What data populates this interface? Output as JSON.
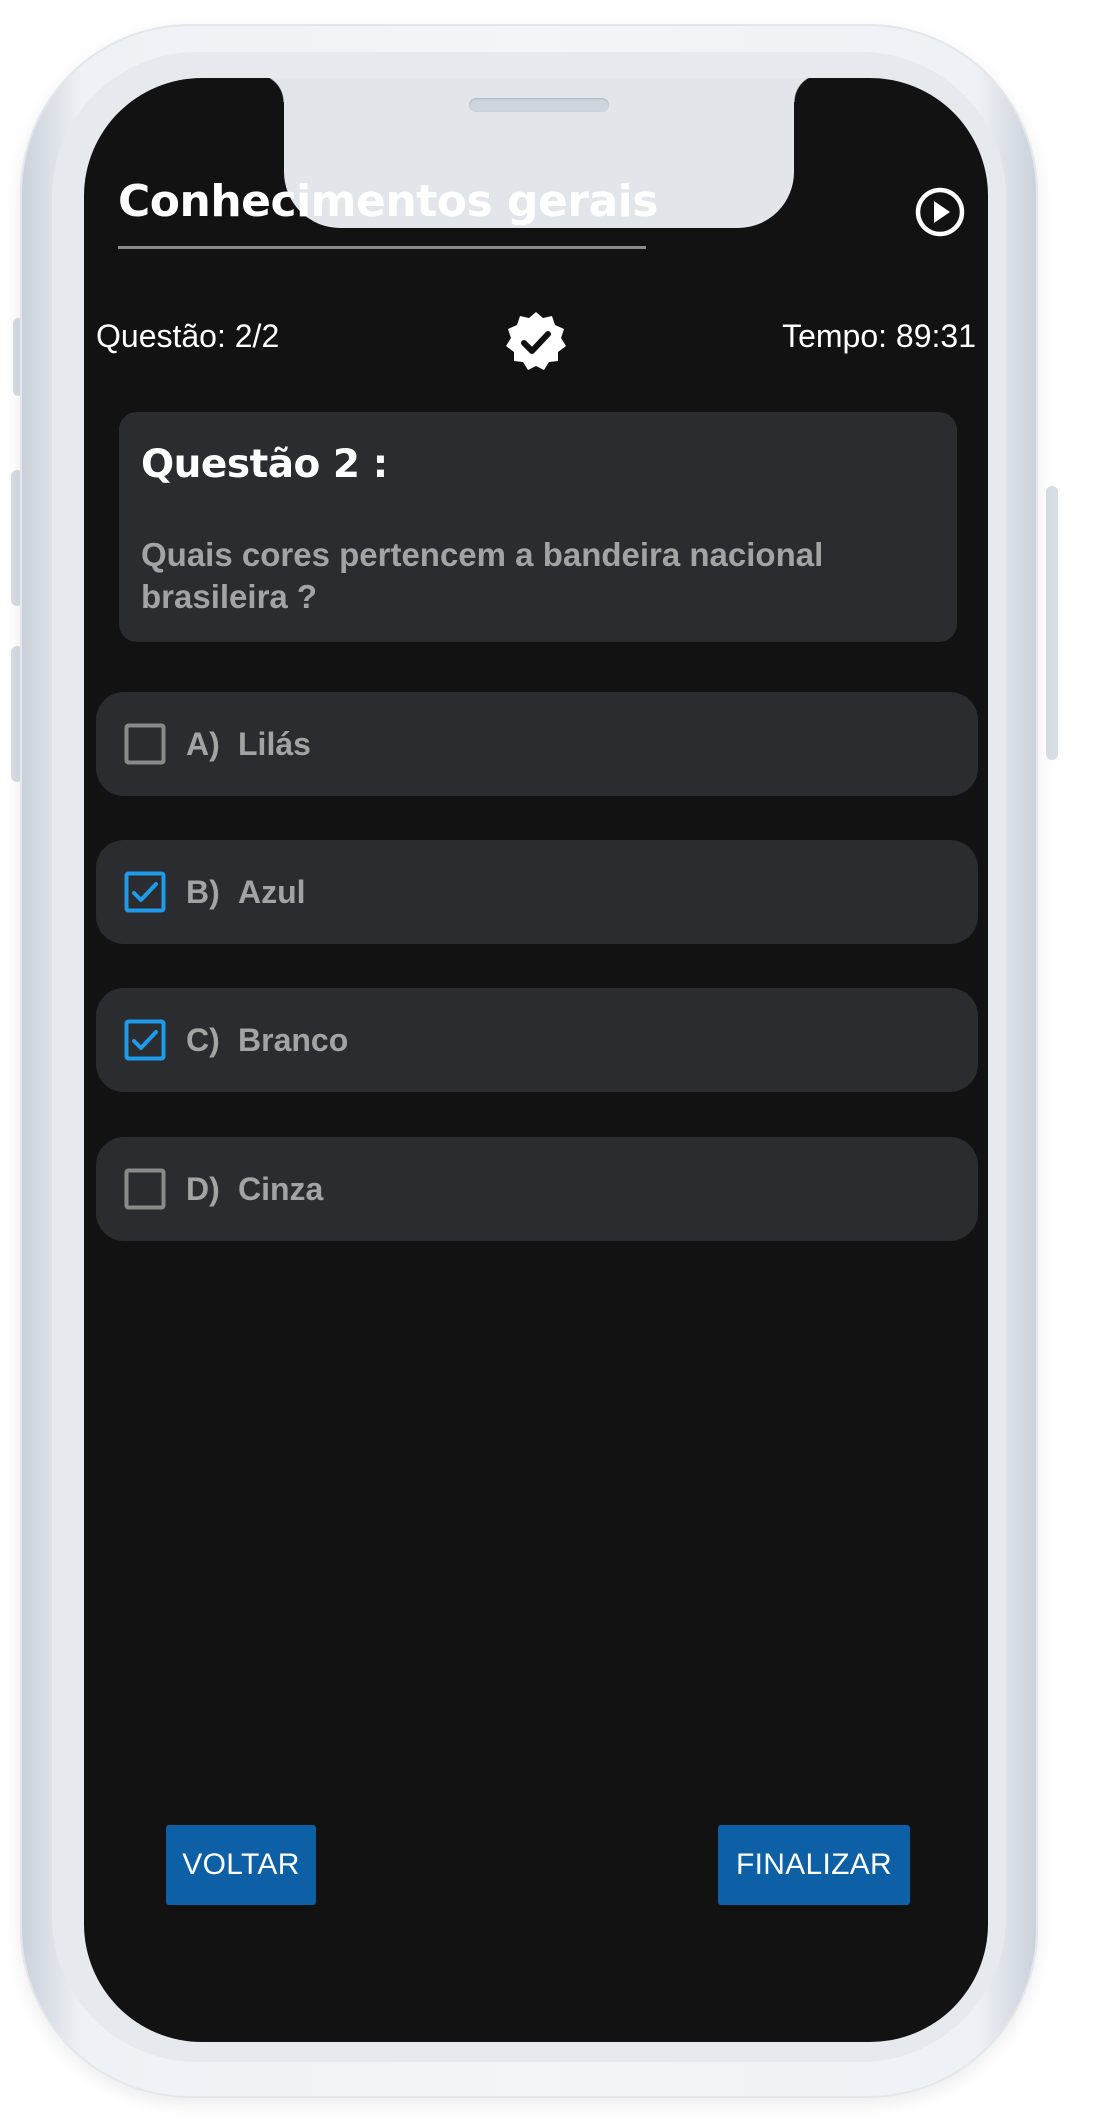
{
  "header": {
    "title": "Conhecimentos gerais"
  },
  "status": {
    "question_counter": "Questão: 2/2",
    "timer": "Tempo: 89:31"
  },
  "question": {
    "heading": "Questão 2 :",
    "text": "Quais cores pertencem a bandeira nacional brasileira ?"
  },
  "options": [
    {
      "letter": "A)",
      "text": "Lilás",
      "checked": false
    },
    {
      "letter": "B)",
      "text": "Azul",
      "checked": true
    },
    {
      "letter": "C)",
      "text": "Branco",
      "checked": true
    },
    {
      "letter": "D)",
      "text": "Cinza",
      "checked": false
    }
  ],
  "buttons": {
    "back_label": "VOLTAR",
    "finish_label": "FINALIZAR"
  },
  "colors": {
    "screen_bg": "#121212",
    "card_bg": "#2a2c30",
    "checkbox_checked": "#1e9be9",
    "checkbox_unchecked": "#8a8a8a",
    "button_bg": "#0d5fa6"
  },
  "icons": {
    "play": "play-circle-icon",
    "verified": "verified-badge-icon",
    "checkbox_checked": "checkbox-checked-icon",
    "checkbox_unchecked": "checkbox-empty-icon"
  }
}
